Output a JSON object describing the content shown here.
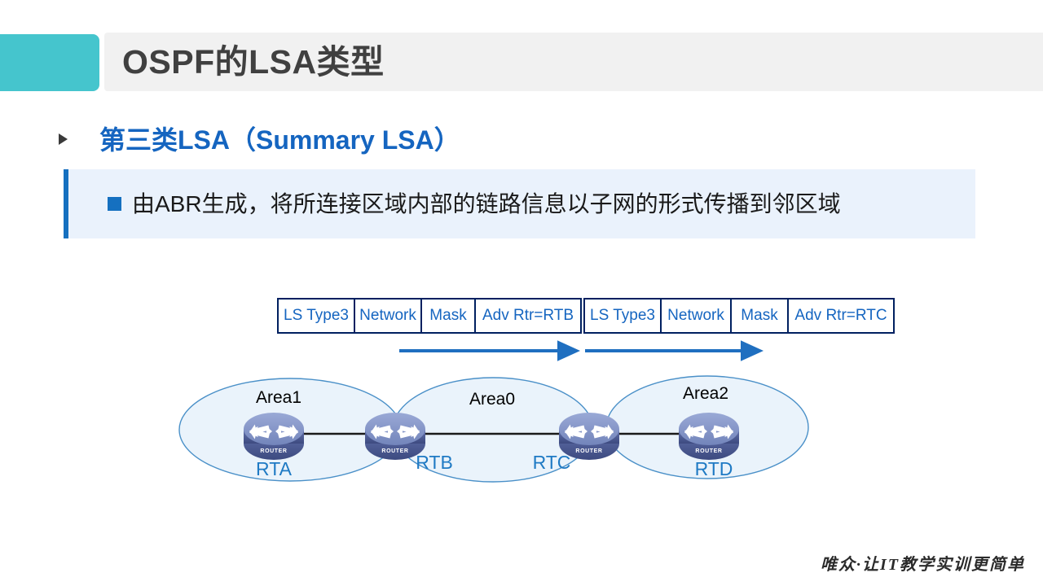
{
  "slide": {
    "title": "OSPF的LSA类型",
    "accent_color": "#45c5cd",
    "title_plate_color": "#f1f1f1",
    "subtitle": "第三类LSA（Summary LSA）",
    "subtitle_color": "#1565c0",
    "description": "由ABR生成，将所连接区域内部的链路信息以子网的形式传播到邻区域",
    "callout_bg": "#eaf2fc",
    "callout_border": "#1570c0",
    "footer": "唯众·让IT教学实训更简单"
  },
  "lsa_packets": [
    {
      "name": "lsa-packet-rtb",
      "cells": [
        "LS Type3",
        "Network",
        "Mask",
        "Adv Rtr=RTB"
      ]
    },
    {
      "name": "lsa-packet-rtc",
      "cells": [
        "LS Type3",
        "Network",
        "Mask",
        "Adv Rtr=RTC"
      ]
    }
  ],
  "diagram": {
    "arrow_color": "#1f6fc0",
    "ellipse_fill": "#eaf3fb",
    "ellipse_stroke": "#4a90c8",
    "link_color": "#1a1a1a",
    "router_top_color": "#8ea0d0",
    "router_body_color": "#4a5a96",
    "areas": [
      {
        "label": "Area0"
      },
      {
        "label": "Area1"
      },
      {
        "label": "Area2"
      }
    ],
    "routers": [
      {
        "label": "RTA",
        "caption": "ROUTER"
      },
      {
        "label": "RTB",
        "caption": "ROUTER"
      },
      {
        "label": "RTC",
        "caption": "ROUTER"
      },
      {
        "label": "RTD",
        "caption": "ROUTER"
      }
    ]
  }
}
